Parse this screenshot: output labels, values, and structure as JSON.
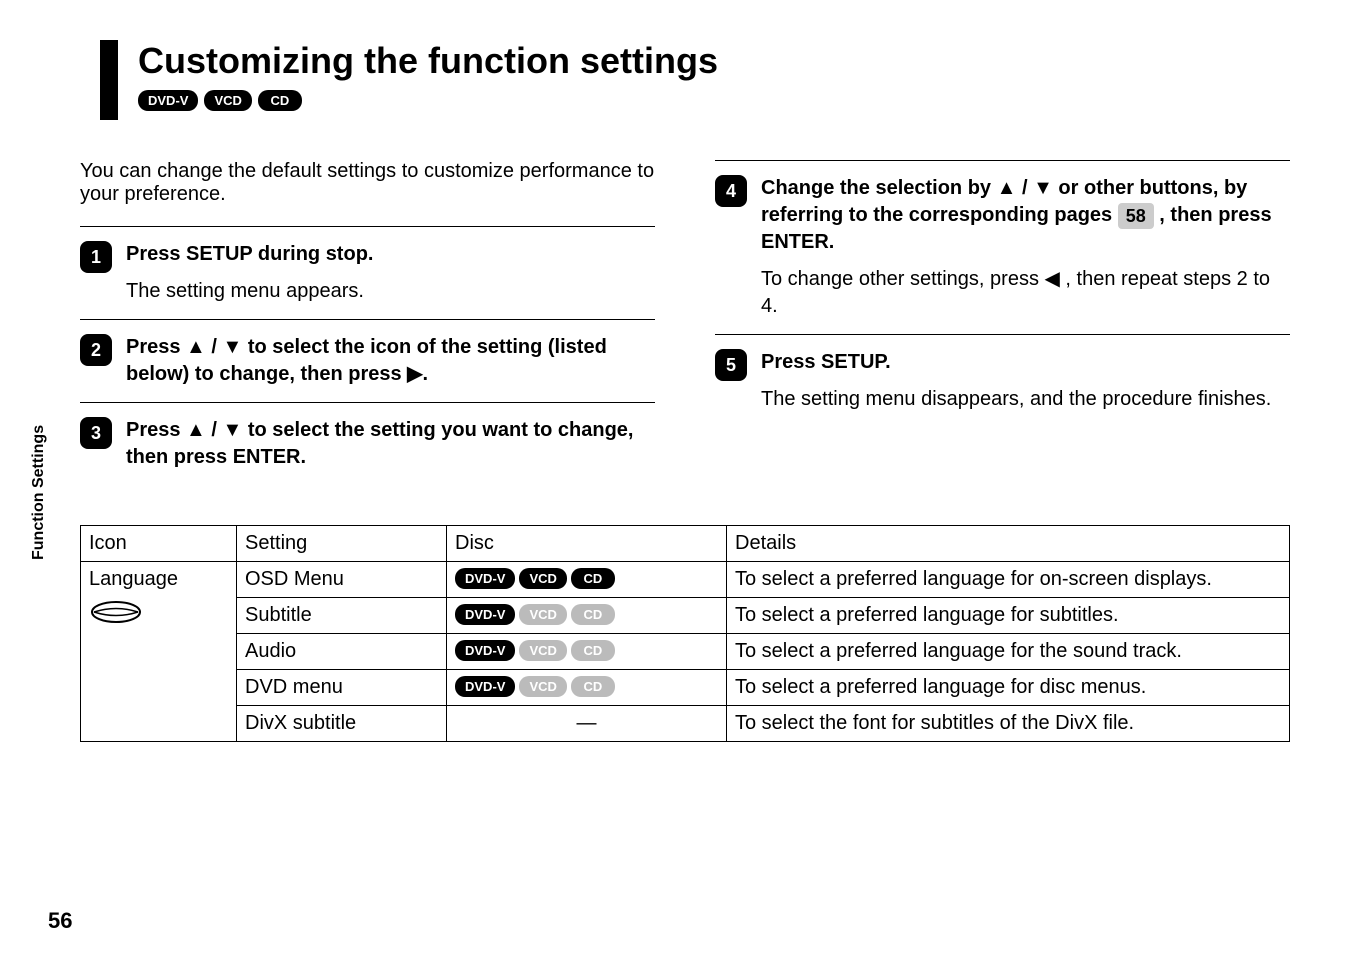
{
  "sidebar": "Function Settings",
  "pageNumber": "56",
  "title": "Customizing the function settings",
  "titleBadges": [
    "DVD-V",
    "VCD",
    "CD"
  ],
  "intro": "You can change the default settings to customize performance to your preference.",
  "stepsLeft": [
    {
      "num": "1",
      "title": "Press SETUP during stop.",
      "desc": "The setting menu appears."
    },
    {
      "num": "2",
      "title": "Press ▲ / ▼ to select the icon of the setting (listed below) to change, then press ▶.",
      "desc": ""
    },
    {
      "num": "3",
      "title": "Press ▲ / ▼ to select the setting you want to change, then press ENTER.",
      "desc": ""
    }
  ],
  "stepsRight": [
    {
      "num": "4",
      "titlePre": "Change the selection by ▲ / ▼ or other buttons, by referring to the corresponding pages ",
      "pageRef": "58",
      "titlePost": " , then press ENTER.",
      "desc": "To change other settings, press ◀ , then repeat steps 2 to 4."
    },
    {
      "num": "5",
      "title": "Press SETUP.",
      "desc": "The setting menu disappears, and the procedure finishes."
    }
  ],
  "table": {
    "headers": [
      "Icon",
      "Setting",
      "Disc",
      "Details"
    ],
    "groupLabel": "Language",
    "rows": [
      {
        "setting": "OSD Menu",
        "disc": [
          {
            "label": "DVD-V",
            "active": true
          },
          {
            "label": "VCD",
            "active": true
          },
          {
            "label": "CD",
            "active": true
          }
        ],
        "details": "To select a preferred language for on-screen displays."
      },
      {
        "setting": "Subtitle",
        "disc": [
          {
            "label": "DVD-V",
            "active": true
          },
          {
            "label": "VCD",
            "active": false
          },
          {
            "label": "CD",
            "active": false
          }
        ],
        "details": "To select a preferred language for subtitles."
      },
      {
        "setting": "Audio",
        "disc": [
          {
            "label": "DVD-V",
            "active": true
          },
          {
            "label": "VCD",
            "active": false
          },
          {
            "label": "CD",
            "active": false
          }
        ],
        "details": "To select a preferred language for the sound track."
      },
      {
        "setting": "DVD menu",
        "disc": [
          {
            "label": "DVD-V",
            "active": true
          },
          {
            "label": "VCD",
            "active": false
          },
          {
            "label": "CD",
            "active": false
          }
        ],
        "details": "To select a preferred language for disc menus."
      },
      {
        "setting": "DivX subtitle",
        "disc": null,
        "dash": "—",
        "details": "To select the font for subtitles of the DivX file."
      }
    ]
  }
}
